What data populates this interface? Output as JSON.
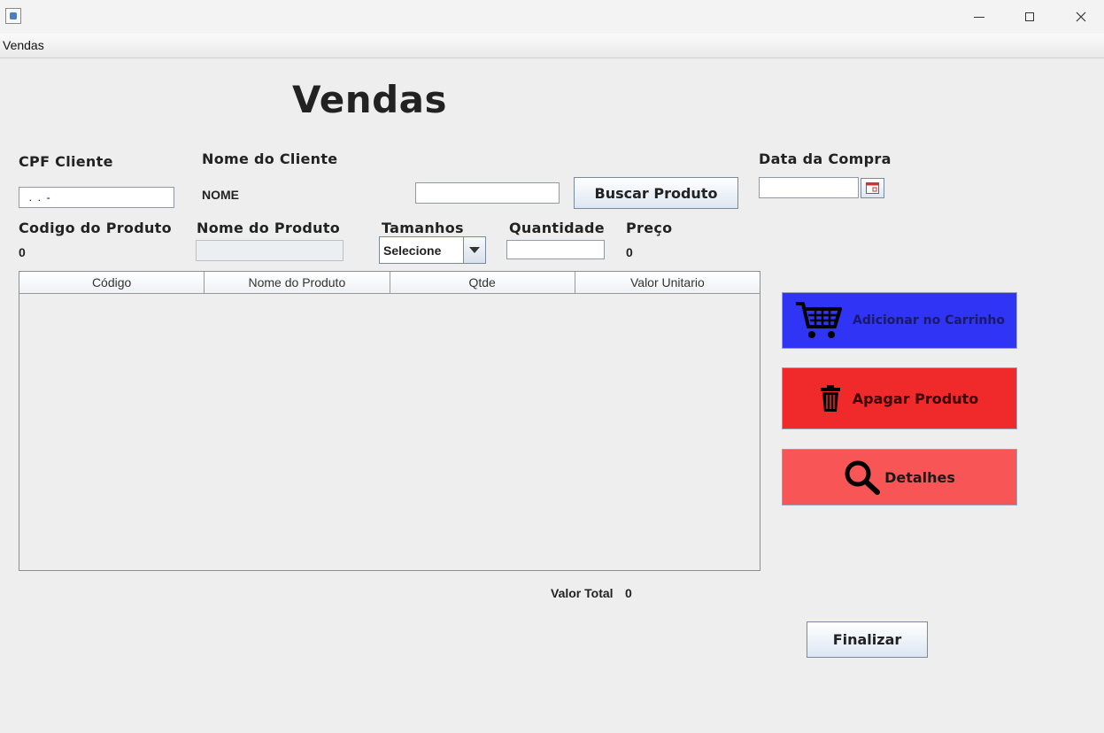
{
  "window": {
    "icon": "java-coffee-icon",
    "controls": [
      "minimize-icon",
      "maximize-icon",
      "close-icon"
    ]
  },
  "menu": {
    "items": [
      "Vendas"
    ]
  },
  "page": {
    "title": "Vendas"
  },
  "cliente": {
    "cpf_label": "CPF Cliente",
    "cpf_value": "  .  .  -",
    "nome_label": "Nome do Cliente",
    "nome_value": "NOME"
  },
  "busca": {
    "value": "",
    "button_label": "Buscar Produto"
  },
  "compra": {
    "data_label": "Data da Compra",
    "data_value": "",
    "calendar_icon": "calendar-icon"
  },
  "produto": {
    "codigo_label": "Codigo do Produto",
    "codigo_value": "0",
    "nome_label": "Nome do Produto",
    "nome_value": "",
    "tamanhos_label": "Tamanhos",
    "tamanhos_selected": "Selecione",
    "quantidade_label": "Quantidade",
    "quantidade_value": "",
    "preco_label": "Preço",
    "preco_value": "0"
  },
  "table": {
    "columns": [
      "Código",
      "Nome do Produto",
      "Qtde",
      "Valor Unitario"
    ],
    "rows": []
  },
  "actions": {
    "add_label": "Adicionar no Carrinho",
    "add_color": "#3034f5",
    "add_icon": "shopping-cart-icon",
    "delete_label": "Apagar Produto",
    "delete_color": "#f02a2a",
    "delete_icon": "trash-icon",
    "details_label": "Detalhes",
    "details_color": "#f85557",
    "details_icon": "search-icon"
  },
  "total": {
    "label": "Valor Total",
    "value": "0"
  },
  "finalizar": {
    "label": "Finalizar"
  }
}
